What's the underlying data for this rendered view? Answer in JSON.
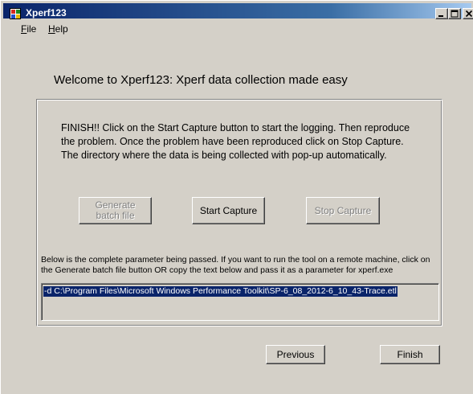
{
  "window": {
    "title": "Xperf123"
  },
  "menu": [
    {
      "mnemonic": "F",
      "rest": "ile"
    },
    {
      "mnemonic": "H",
      "rest": "elp"
    }
  ],
  "welcome": "Welcome to Xperf123: Xperf data collection made easy",
  "instructions": "FINISH!! Click on the Start Capture button to start the logging. Then reproduce the problem. Once the problem have been reproduced click on Stop Capture. The directory where the data is being collected with pop-up automatically.",
  "buttons": {
    "generate": "Generate batch file",
    "start_capture": "Start Capture",
    "stop_capture": "Stop Capture"
  },
  "parameter": {
    "label": "Below is the complete parameter being passed. If you want to run the tool on a remote machine, click on the Generate batch file button OR copy the text below and pass it as a parameter for xperf.exe",
    "value": "-d C:\\Program Files\\Microsoft Windows Performance Toolkit\\SP-6_08_2012-6_10_43-Trace.etl"
  },
  "footer": {
    "previous": "Previous",
    "finish": "Finish"
  },
  "colors": {
    "titlebar_start": "#0a246a",
    "titlebar_end": "#a6caf0",
    "face": "#d4d0c8",
    "selection": "#0a246a"
  }
}
